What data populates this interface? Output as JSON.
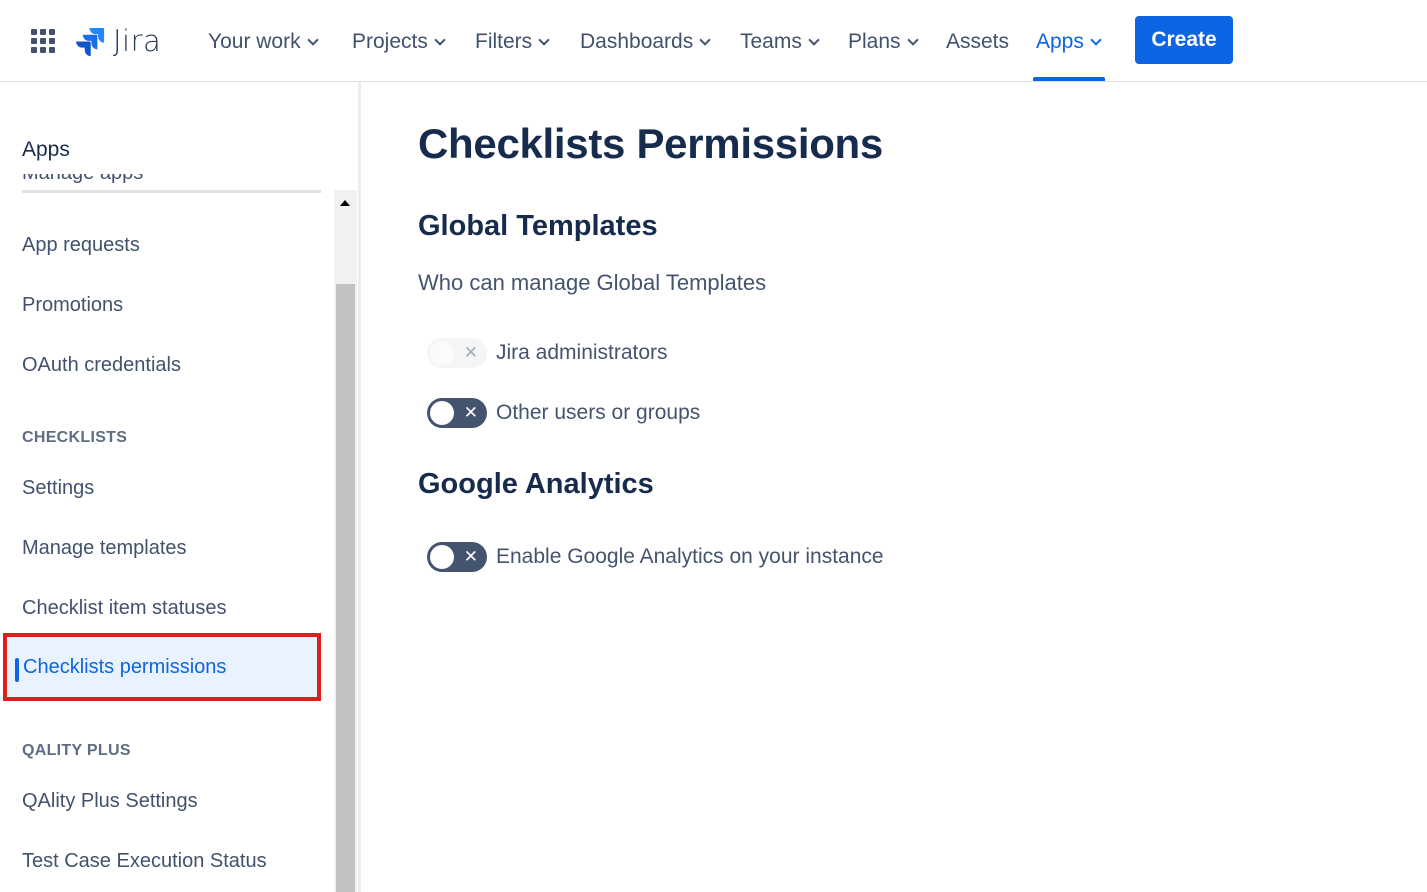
{
  "topnav": {
    "logo_text": "Jira",
    "items": [
      {
        "label": "Your work"
      },
      {
        "label": "Projects"
      },
      {
        "label": "Filters"
      },
      {
        "label": "Dashboards"
      },
      {
        "label": "Teams"
      },
      {
        "label": "Plans"
      },
      {
        "label": "Assets"
      },
      {
        "label": "Apps"
      }
    ],
    "create_label": "Create",
    "accent_color": "#0c66e4"
  },
  "sidebar": {
    "title": "Apps",
    "clipped_item": "Manage apps",
    "items": [
      {
        "label": "App requests"
      },
      {
        "label": "Promotions"
      },
      {
        "label": "OAuth credentials"
      }
    ],
    "checklists_heading": "CHECKLISTS",
    "checklists_items": [
      {
        "label": "Settings"
      },
      {
        "label": "Manage templates"
      },
      {
        "label": "Checklist item statuses"
      },
      {
        "label": "Checklists permissions"
      }
    ],
    "qality_heading": "QALITY PLUS",
    "qality_items": [
      {
        "label": "QAlity Plus Settings"
      },
      {
        "label": "Test Case Execution Status"
      }
    ],
    "selected_highlight_color": "#e01e1e"
  },
  "main": {
    "title": "Checklists Permissions",
    "global_templates": {
      "heading": "Global Templates",
      "subheading": "Who can manage Global Templates",
      "toggles": [
        {
          "label": "Jira administrators",
          "state": "off",
          "disabled": true
        },
        {
          "label": "Other users or groups",
          "state": "off",
          "disabled": false
        }
      ]
    },
    "google_analytics": {
      "heading": "Google Analytics",
      "toggles": [
        {
          "label": "Enable Google Analytics on your instance",
          "state": "off",
          "disabled": false
        }
      ]
    }
  }
}
